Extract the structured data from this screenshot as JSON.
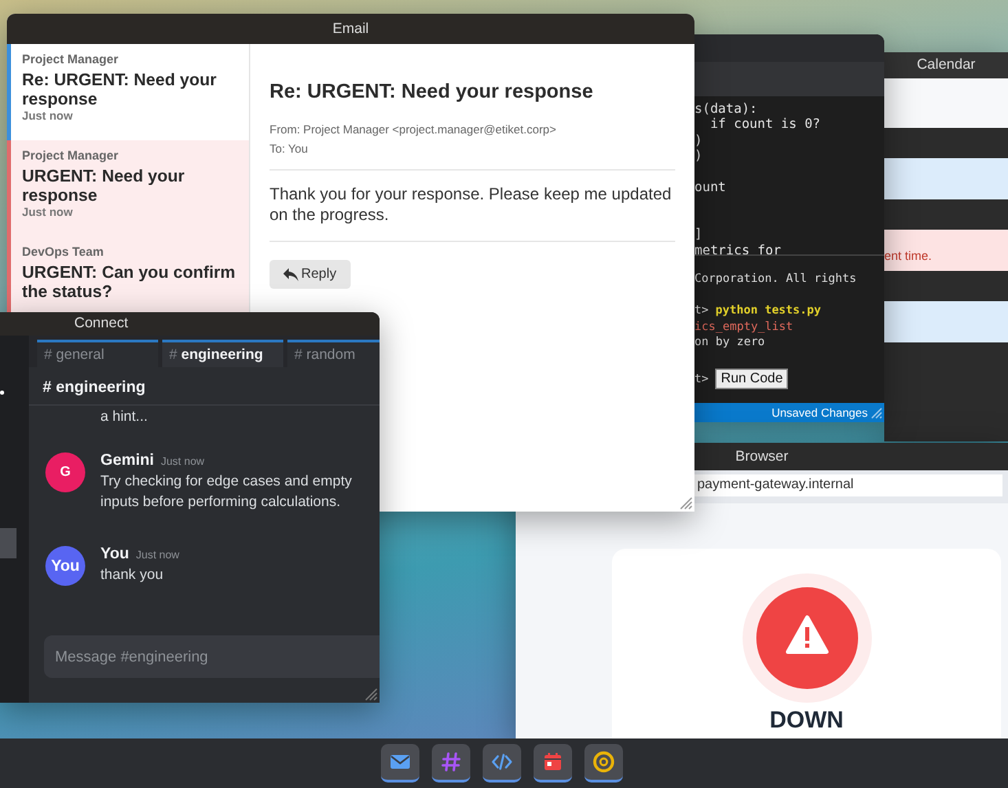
{
  "calendar": {
    "title": "Calendar",
    "entries": [
      {
        "color": "#f7f8fa"
      },
      {
        "color": "#dcecfb"
      },
      {
        "color": "#fde3e3",
        "text": "ent time."
      },
      {
        "color": "#dcecfb"
      }
    ]
  },
  "code_editor": {
    "code_lines": [
      {
        "kind": "code",
        "text": "s(data):"
      },
      {
        "kind": "code",
        "text": "  if count is 0?"
      },
      {
        "kind": "code",
        "text": ")"
      },
      {
        "kind": "code",
        "text": ")"
      },
      {
        "kind": "blank"
      },
      {
        "kind": "code",
        "text": "ount"
      },
      {
        "kind": "blank"
      },
      {
        "kind": "blank"
      },
      {
        "kind": "code",
        "text": "]"
      },
      {
        "kind": "code",
        "text": "metrics for"
      }
    ],
    "terminal": [
      {
        "kind": "output",
        "text": "Corporation. All rights"
      },
      {
        "kind": "blank"
      },
      {
        "kind": "command",
        "prompt": "t>",
        "text": "python tests.py"
      },
      {
        "kind": "error",
        "text": "ics_empty_list"
      },
      {
        "kind": "output",
        "text": "on by zero"
      },
      {
        "kind": "blank"
      },
      {
        "kind": "run",
        "prompt": "t>",
        "text": "Run Code"
      }
    ],
    "status": "Unsaved Changes"
  },
  "browser": {
    "title": "Browser",
    "address": "payment-gateway.internal",
    "status": {
      "kind": "down",
      "label": "DOWN"
    }
  },
  "email": {
    "title": "Email",
    "messages": [
      {
        "sender": "Project Manager",
        "subject": "Re: URGENT: Need your response",
        "time": "Just now",
        "selected": true,
        "highlighted": false
      },
      {
        "sender": "Project Manager",
        "subject": "URGENT: Need your response",
        "time": "Just now",
        "selected": false,
        "highlighted": true
      },
      {
        "sender": "DevOps Team",
        "subject": "URGENT: Can you confirm the status?",
        "selected": false,
        "highlighted": true
      }
    ],
    "open_message": {
      "subject": "Re: URGENT: Need your response",
      "from": "From: Project Manager <project.manager@etiket.corp>",
      "to": "To: You",
      "body": "Thank you for your response. Please keep me updated on the progress.",
      "reply": "Reply"
    }
  },
  "connect": {
    "title": "Connect",
    "tabs": [
      {
        "prefix": "#",
        "label": "general",
        "selected": false
      },
      {
        "prefix": "#",
        "label": "engineering",
        "selected": true
      },
      {
        "prefix": "#",
        "label": "random",
        "selected": false
      }
    ],
    "channel": {
      "prefix": "#",
      "name": "engineering"
    },
    "messages": [
      {
        "kind": "continuation",
        "text": "a hint..."
      },
      {
        "kind": "message",
        "avatar": "G",
        "color": "#e91e63",
        "author": "Gemini",
        "time": "Just now",
        "text": "Try checking for edge cases and empty inputs before performing calculations."
      },
      {
        "kind": "message",
        "avatar": "You",
        "color": "#5865f2",
        "author": "You",
        "time": "Just now",
        "text": "thank you"
      }
    ],
    "input": {
      "placeholder": "Message #engineering"
    }
  },
  "taskbar": [
    {
      "kind": "mail",
      "open": true
    },
    {
      "kind": "chat",
      "open": true
    },
    {
      "kind": "code",
      "open": true
    },
    {
      "kind": "calendar",
      "open": true
    },
    {
      "kind": "browser",
      "open": true
    }
  ]
}
